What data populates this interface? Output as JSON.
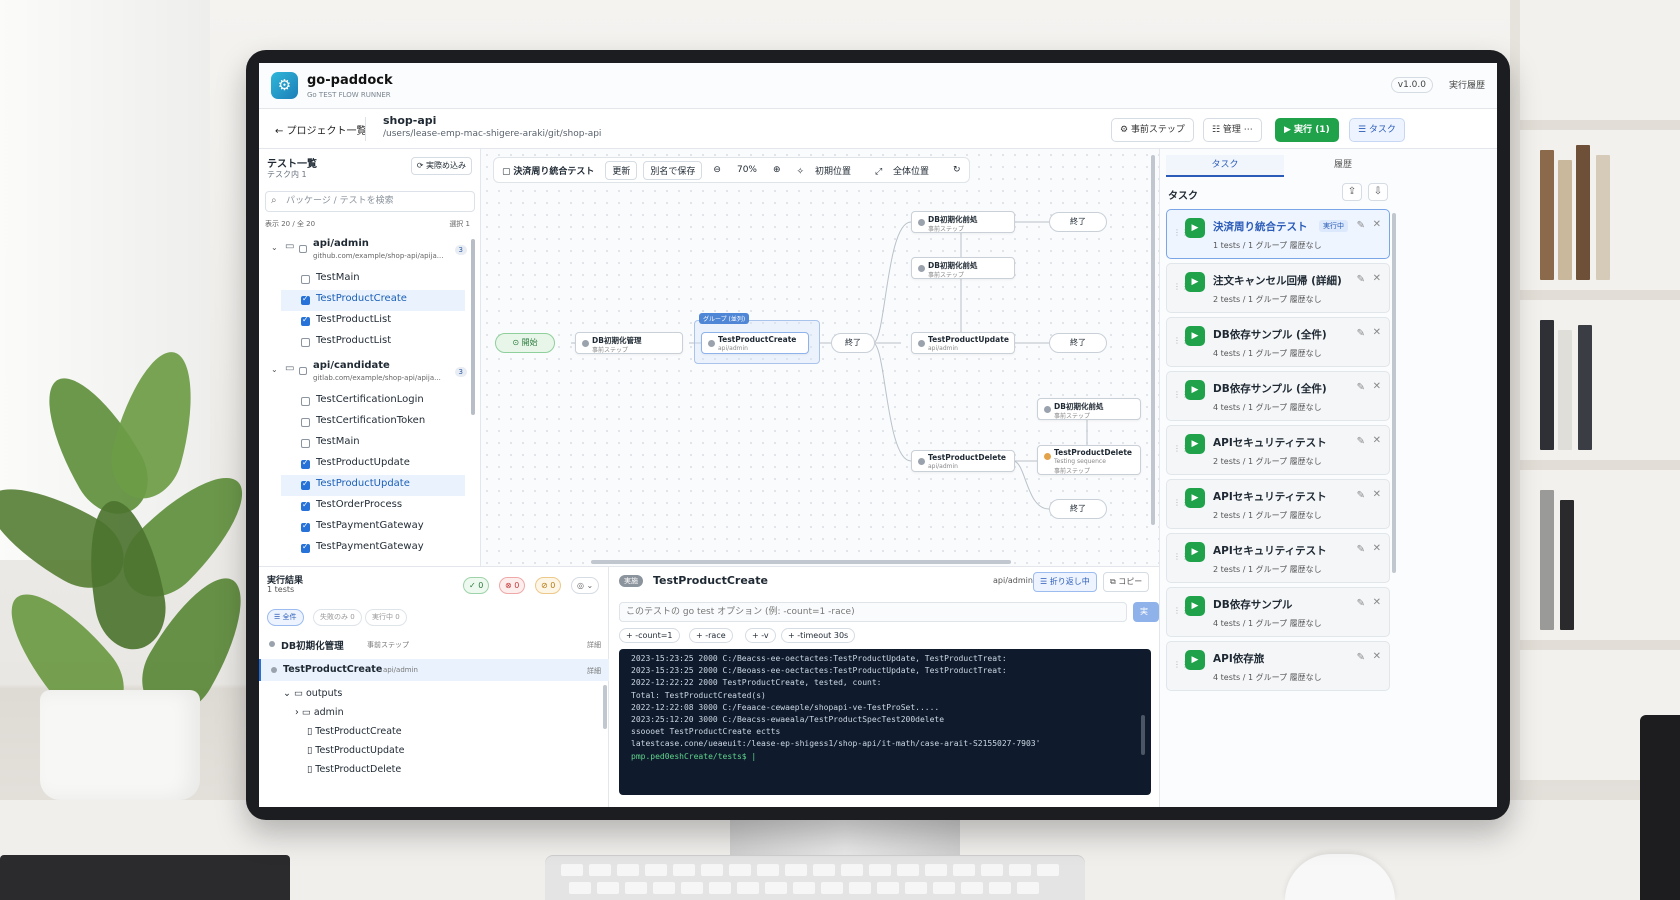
{
  "app": {
    "name": "go-paddock",
    "subtitle": "Go TEST FLOW RUNNER",
    "version": "v1.0.0",
    "history": "実行履歴"
  },
  "subbar": {
    "back": "← プロジェクト一覧",
    "project_name": "shop-api",
    "project_path": "/users/lease-emp-mac-shigere-araki/git/shop-api",
    "buttons": {
      "prestep": "⚙ 事前ステップ",
      "manage": "☷ 管理 ⋯",
      "run": "▶ 実行 (1)",
      "tasks": "☰ タスク"
    }
  },
  "tests_panel": {
    "title": "テスト一覧",
    "subtitle": "テスク内 1",
    "load_button": "⟳ 実際め込み",
    "search_placeholder": "パッケージ / テストを検索",
    "meta_left": "表示 20 / 全 20",
    "meta_right": "選択 1",
    "groups": [
      {
        "name": "api/admin",
        "path": "github.com/example/shop-api/apija...",
        "count": "3",
        "items": [
          {
            "name": "TestMain",
            "checked": false,
            "selected": false
          },
          {
            "name": "TestProductCreate",
            "checked": true,
            "selected": true
          },
          {
            "name": "TestProductList",
            "checked": true,
            "selected": false
          },
          {
            "name": "TestProductList",
            "checked": false,
            "selected": false
          }
        ]
      },
      {
        "name": "api/candidate",
        "path": "gitlab.com/example/shop-api/apija...",
        "count": "3",
        "items": [
          {
            "name": "TestCertificationLogin",
            "checked": false,
            "selected": false
          },
          {
            "name": "TestCertificationToken",
            "checked": false,
            "selected": false
          },
          {
            "name": "TestMain",
            "checked": false,
            "selected": false
          },
          {
            "name": "TestProductUpdate",
            "checked": true,
            "selected": false
          },
          {
            "name": "TestProductUpdate",
            "checked": true,
            "selected": true
          },
          {
            "name": "TestOrderProcess",
            "checked": true,
            "selected": false
          },
          {
            "name": "TestPaymentGateway",
            "checked": true,
            "selected": false
          },
          {
            "name": "TestPaymentGateway",
            "checked": true,
            "selected": false
          }
        ]
      }
    ]
  },
  "canvas": {
    "toolbar": {
      "title": "決済周り統合テスト",
      "update": "更新",
      "save_as": "別名で保存",
      "zoom": "70%",
      "initial": "初期位置",
      "fit": "全体位置"
    },
    "group_tag": "グループ (並列)",
    "nodes": {
      "start": "⊙ 開始",
      "db_init": "DB初期化管理",
      "db_init_sub": "事前ステップ",
      "create": "TestProductCreate",
      "create_sub": "api/admin",
      "end1": "終了",
      "db_top1": "DB初期化前処",
      "db_top1_sub": "事前ステップ",
      "db_top2": "DB初期化前処",
      "db_top2_sub": "事前ステップ",
      "update": "TestProductUpdate",
      "update_sub": "api/admin",
      "delete": "TestProductDelete",
      "delete_sub": "api/admin",
      "db_right": "DB初期化前処",
      "db_right_sub": "事前ステップ",
      "delete2": "TestProductDelete",
      "delete2_sub": "Testing sequence",
      "delete2_sub2": "事前ステップ",
      "end_top": "終了",
      "end_mid": "終了",
      "end_bottom": "終了"
    }
  },
  "tasks_panel": {
    "tabs": [
      "タスク",
      "履歴"
    ],
    "header": "タスク",
    "items": [
      {
        "name": "決済周り統合テスト",
        "meta": "1 tests / 1 グループ  履歴なし",
        "badge": "実行中",
        "active": true
      },
      {
        "name": "注文キャンセル回帰 (詳細)",
        "meta": "2 tests / 1 グループ  履歴なし",
        "badge": "",
        "active": false
      },
      {
        "name": "DB依存サンプル (全件)",
        "meta": "4 tests / 1 グループ  履歴なし",
        "badge": "",
        "active": false
      },
      {
        "name": "DB依存サンプル (全件)",
        "meta": "4 tests / 1 グループ  履歴なし",
        "badge": "",
        "active": false
      },
      {
        "name": "APIセキュリティテスト",
        "meta": "2 tests / 1 グループ  履歴なし",
        "badge": "",
        "active": false
      },
      {
        "name": "APIセキュリティテスト",
        "meta": "2 tests / 1 グループ  履歴なし",
        "badge": "",
        "active": false
      },
      {
        "name": "APIセキュリティテスト",
        "meta": "2 tests / 1 グループ  履歴なし",
        "badge": "",
        "active": false
      },
      {
        "name": "DB依存サンプル",
        "meta": "4 tests / 1 グループ  履歴なし",
        "badge": "",
        "active": false
      },
      {
        "name": "API依存旅",
        "meta": "4 tests / 1 グループ  履歴なし",
        "badge": "",
        "active": false
      }
    ]
  },
  "results": {
    "title": "実行結果",
    "subtitle": "1 tests",
    "stats": {
      "pass": "0",
      "fail": "0",
      "skip": "0"
    },
    "filters": {
      "all": "☰ 全件",
      "failed": "失敗のみ 0",
      "running": "実行中 0"
    },
    "rows": [
      {
        "name": "DB初期化管理",
        "sub": "事前ステップ",
        "detail": "詳細"
      },
      {
        "name": "TestProductCreate",
        "sub": "api/admin",
        "detail": "詳細"
      }
    ],
    "tree": {
      "outputs": "outputs",
      "admin": "admin",
      "f1": "TestProductCreate",
      "f2": "TestProductUpdate",
      "f3": "TestProductDelete"
    }
  },
  "detail": {
    "status": "実施",
    "title": "TestProductCreate",
    "group": "api/admin",
    "wrap_button": "☰ 折り返し中",
    "copy_button": "⧉ コピー",
    "option_placeholder": "このテストの go test オプション (例: -count=1 -race)",
    "apply": "実行",
    "chips": [
      "+ -count=1",
      "+ -race",
      "+ -v",
      "+ -timeout 30s"
    ],
    "log": [
      "2023-15:23:25 2000 C:/Beacss-ee-oectactes:TestProductUpdate, TestProductTreat:",
      "2023-15:23:25 2000 C:/Beoass-ee-oectactes:TestProductUpdate, TestProductTreat:",
      "2022-12:22:22 2000 TestProductCreate, tested, count:",
      "  Total: TestProductCreated(s)",
      "2022-12:22:08 3000 C:/Feaace-cewaeple/shopapi-ve-TestProSet.....",
      "2023:25:12:20 3000 C:/Beacss-ewaeala/TestProductSpecTest200delete",
      "ssoooet TestProductCreate ectts",
      "latestcase.cone/ueaeuit:/lease-ep-shigess1/shop-api/it-math/case-arait-S2155027-7903'",
      "pmp.ped0eshCreate/tests$ |"
    ]
  },
  "colors": {
    "accent": "#2a5bb8",
    "run": "#1fa24a",
    "terminal": "#0f1b2d"
  }
}
